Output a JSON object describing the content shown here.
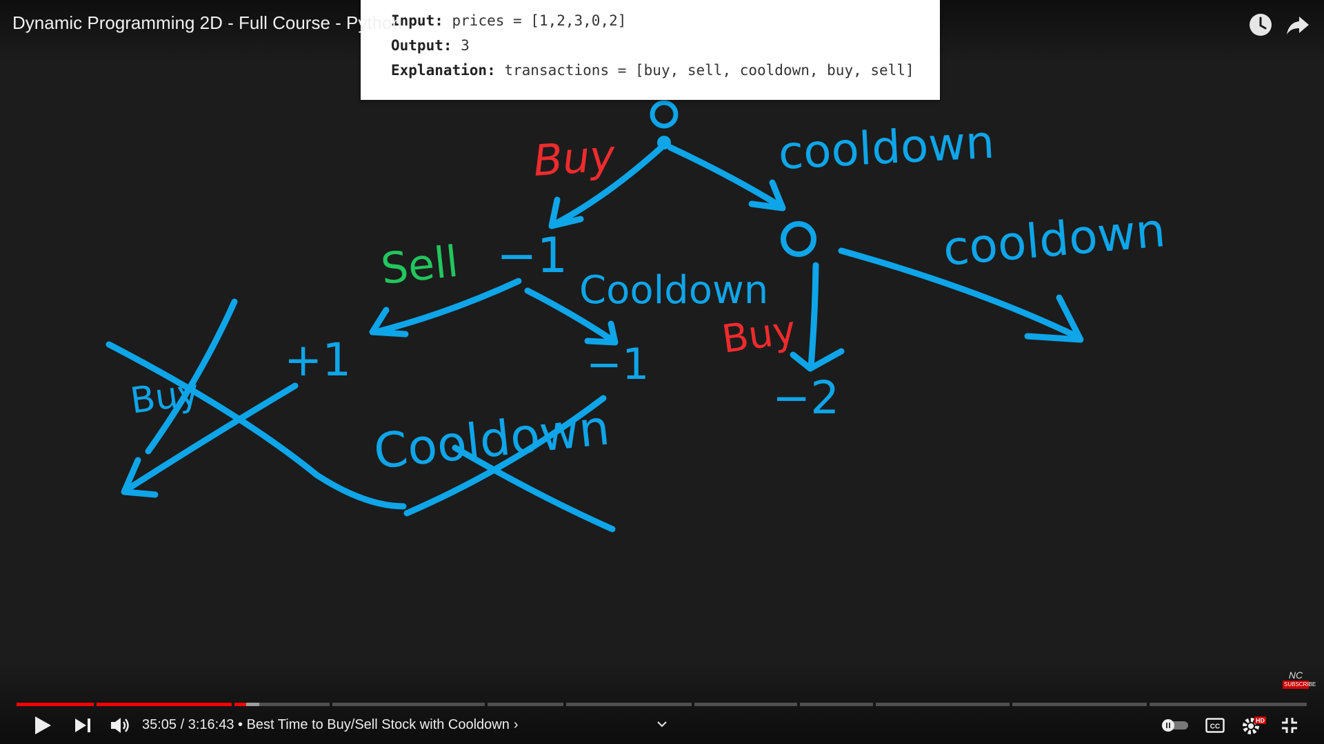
{
  "video": {
    "title": "Dynamic Programming 2D - Full Course - Python",
    "watch_later_icon": "clock-icon",
    "share_icon": "share-arrow-icon"
  },
  "problem_card": {
    "input_label": "Input:",
    "input_value": "prices = [1,2,3,0,2]",
    "output_label": "Output:",
    "output_value": "3",
    "explanation_label": "Explanation:",
    "explanation_value": "transactions = [buy, sell, cooldown, buy, sell]"
  },
  "drawing": {
    "colors": {
      "blue": "#0ea5e9",
      "red": "#ef2b2d",
      "green": "#22c55e"
    },
    "labels": {
      "root_node": "0",
      "buy_top": "Buy",
      "cooldown_top": "cooldown",
      "minus_one_left": "−1",
      "sell": "Sell",
      "cooldown_mid": "Cooldown",
      "node_right": "0",
      "cooldown_right": "cooldown",
      "buy_right": "Buy",
      "minus_two": "−2",
      "plus_one": "+1",
      "minus_one_right": "−1",
      "crossed_buy": "Buy",
      "crossed_cooldown": "Cooldown"
    }
  },
  "player": {
    "current_time": "35:05",
    "duration": "3:16:43",
    "separator": " / ",
    "bullet": " • ",
    "chapter_title": "Best Time to Buy/Sell Stock with Cooldown",
    "chapter_chevron": "›",
    "played_fraction": 0.178,
    "buffered_fraction": 0.188,
    "accent_color": "#ff0000",
    "hd_badge": "HD",
    "icons": {
      "play": "play-icon",
      "next": "next-icon",
      "volume": "volume-icon",
      "autoplay": "autoplay-toggle-icon",
      "captions": "captions-icon",
      "settings": "settings-gear-icon",
      "exit_fullscreen": "exit-fullscreen-icon",
      "expand": "chevron-down-icon"
    }
  },
  "watermark": {
    "logo": "NC",
    "subscribe": "SUBSCRIBE"
  }
}
